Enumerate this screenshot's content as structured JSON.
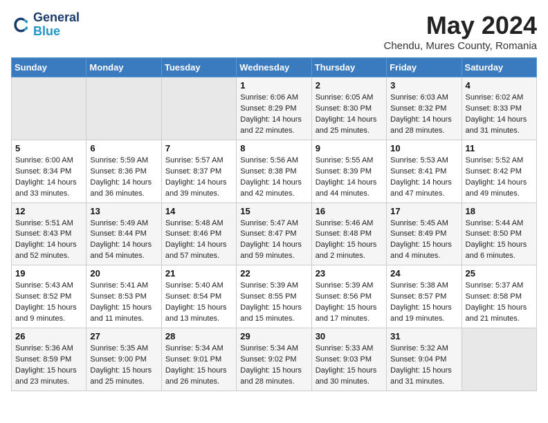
{
  "logo": {
    "line1": "General",
    "line2": "Blue"
  },
  "title": "May 2024",
  "location": "Chendu, Mures County, Romania",
  "days_of_week": [
    "Sunday",
    "Monday",
    "Tuesday",
    "Wednesday",
    "Thursday",
    "Friday",
    "Saturday"
  ],
  "weeks": [
    [
      {
        "day": "",
        "empty": true
      },
      {
        "day": "",
        "empty": true
      },
      {
        "day": "",
        "empty": true
      },
      {
        "day": "1",
        "sunrise": "Sunrise: 6:06 AM",
        "sunset": "Sunset: 8:29 PM",
        "daylight": "Daylight: 14 hours and 22 minutes."
      },
      {
        "day": "2",
        "sunrise": "Sunrise: 6:05 AM",
        "sunset": "Sunset: 8:30 PM",
        "daylight": "Daylight: 14 hours and 25 minutes."
      },
      {
        "day": "3",
        "sunrise": "Sunrise: 6:03 AM",
        "sunset": "Sunset: 8:32 PM",
        "daylight": "Daylight: 14 hours and 28 minutes."
      },
      {
        "day": "4",
        "sunrise": "Sunrise: 6:02 AM",
        "sunset": "Sunset: 8:33 PM",
        "daylight": "Daylight: 14 hours and 31 minutes."
      }
    ],
    [
      {
        "day": "5",
        "sunrise": "Sunrise: 6:00 AM",
        "sunset": "Sunset: 8:34 PM",
        "daylight": "Daylight: 14 hours and 33 minutes."
      },
      {
        "day": "6",
        "sunrise": "Sunrise: 5:59 AM",
        "sunset": "Sunset: 8:36 PM",
        "daylight": "Daylight: 14 hours and 36 minutes."
      },
      {
        "day": "7",
        "sunrise": "Sunrise: 5:57 AM",
        "sunset": "Sunset: 8:37 PM",
        "daylight": "Daylight: 14 hours and 39 minutes."
      },
      {
        "day": "8",
        "sunrise": "Sunrise: 5:56 AM",
        "sunset": "Sunset: 8:38 PM",
        "daylight": "Daylight: 14 hours and 42 minutes."
      },
      {
        "day": "9",
        "sunrise": "Sunrise: 5:55 AM",
        "sunset": "Sunset: 8:39 PM",
        "daylight": "Daylight: 14 hours and 44 minutes."
      },
      {
        "day": "10",
        "sunrise": "Sunrise: 5:53 AM",
        "sunset": "Sunset: 8:41 PM",
        "daylight": "Daylight: 14 hours and 47 minutes."
      },
      {
        "day": "11",
        "sunrise": "Sunrise: 5:52 AM",
        "sunset": "Sunset: 8:42 PM",
        "daylight": "Daylight: 14 hours and 49 minutes."
      }
    ],
    [
      {
        "day": "12",
        "sunrise": "Sunrise: 5:51 AM",
        "sunset": "Sunset: 8:43 PM",
        "daylight": "Daylight: 14 hours and 52 minutes."
      },
      {
        "day": "13",
        "sunrise": "Sunrise: 5:49 AM",
        "sunset": "Sunset: 8:44 PM",
        "daylight": "Daylight: 14 hours and 54 minutes."
      },
      {
        "day": "14",
        "sunrise": "Sunrise: 5:48 AM",
        "sunset": "Sunset: 8:46 PM",
        "daylight": "Daylight: 14 hours and 57 minutes."
      },
      {
        "day": "15",
        "sunrise": "Sunrise: 5:47 AM",
        "sunset": "Sunset: 8:47 PM",
        "daylight": "Daylight: 14 hours and 59 minutes."
      },
      {
        "day": "16",
        "sunrise": "Sunrise: 5:46 AM",
        "sunset": "Sunset: 8:48 PM",
        "daylight": "Daylight: 15 hours and 2 minutes."
      },
      {
        "day": "17",
        "sunrise": "Sunrise: 5:45 AM",
        "sunset": "Sunset: 8:49 PM",
        "daylight": "Daylight: 15 hours and 4 minutes."
      },
      {
        "day": "18",
        "sunrise": "Sunrise: 5:44 AM",
        "sunset": "Sunset: 8:50 PM",
        "daylight": "Daylight: 15 hours and 6 minutes."
      }
    ],
    [
      {
        "day": "19",
        "sunrise": "Sunrise: 5:43 AM",
        "sunset": "Sunset: 8:52 PM",
        "daylight": "Daylight: 15 hours and 9 minutes."
      },
      {
        "day": "20",
        "sunrise": "Sunrise: 5:41 AM",
        "sunset": "Sunset: 8:53 PM",
        "daylight": "Daylight: 15 hours and 11 minutes."
      },
      {
        "day": "21",
        "sunrise": "Sunrise: 5:40 AM",
        "sunset": "Sunset: 8:54 PM",
        "daylight": "Daylight: 15 hours and 13 minutes."
      },
      {
        "day": "22",
        "sunrise": "Sunrise: 5:39 AM",
        "sunset": "Sunset: 8:55 PM",
        "daylight": "Daylight: 15 hours and 15 minutes."
      },
      {
        "day": "23",
        "sunrise": "Sunrise: 5:39 AM",
        "sunset": "Sunset: 8:56 PM",
        "daylight": "Daylight: 15 hours and 17 minutes."
      },
      {
        "day": "24",
        "sunrise": "Sunrise: 5:38 AM",
        "sunset": "Sunset: 8:57 PM",
        "daylight": "Daylight: 15 hours and 19 minutes."
      },
      {
        "day": "25",
        "sunrise": "Sunrise: 5:37 AM",
        "sunset": "Sunset: 8:58 PM",
        "daylight": "Daylight: 15 hours and 21 minutes."
      }
    ],
    [
      {
        "day": "26",
        "sunrise": "Sunrise: 5:36 AM",
        "sunset": "Sunset: 8:59 PM",
        "daylight": "Daylight: 15 hours and 23 minutes."
      },
      {
        "day": "27",
        "sunrise": "Sunrise: 5:35 AM",
        "sunset": "Sunset: 9:00 PM",
        "daylight": "Daylight: 15 hours and 25 minutes."
      },
      {
        "day": "28",
        "sunrise": "Sunrise: 5:34 AM",
        "sunset": "Sunset: 9:01 PM",
        "daylight": "Daylight: 15 hours and 26 minutes."
      },
      {
        "day": "29",
        "sunrise": "Sunrise: 5:34 AM",
        "sunset": "Sunset: 9:02 PM",
        "daylight": "Daylight: 15 hours and 28 minutes."
      },
      {
        "day": "30",
        "sunrise": "Sunrise: 5:33 AM",
        "sunset": "Sunset: 9:03 PM",
        "daylight": "Daylight: 15 hours and 30 minutes."
      },
      {
        "day": "31",
        "sunrise": "Sunrise: 5:32 AM",
        "sunset": "Sunset: 9:04 PM",
        "daylight": "Daylight: 15 hours and 31 minutes."
      },
      {
        "day": "",
        "empty": true
      }
    ]
  ]
}
